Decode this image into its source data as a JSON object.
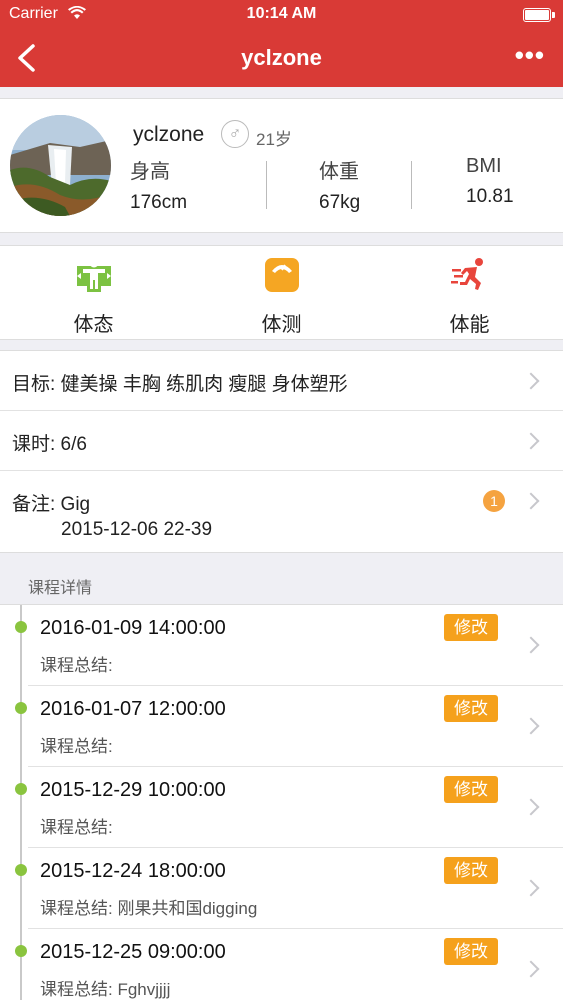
{
  "status_bar": {
    "carrier": "Carrier",
    "time": "10:14 AM"
  },
  "nav": {
    "title": "yclzone",
    "more": "•••"
  },
  "profile": {
    "name": "yclzone",
    "gender_symbol": "♂",
    "age": "21岁",
    "stats": [
      {
        "label": "身高",
        "value": "176cm"
      },
      {
        "label": "体重",
        "value": "67kg"
      },
      {
        "label": "BMI",
        "value": "10.81"
      }
    ]
  },
  "features": [
    {
      "label": "体态",
      "color": "#7cc242"
    },
    {
      "label": "体测",
      "color": "#f5a623"
    },
    {
      "label": "体能",
      "color": "#e8453c"
    }
  ],
  "info": {
    "goal": "目标: 健美操 丰胸 练肌肉 瘦腿 身体塑形",
    "lessons": "课时: 6/6",
    "note_label": "备注: Gig",
    "note_date": "2015-12-06 22-39",
    "note_badge": "1"
  },
  "section": {
    "title": "课程详情"
  },
  "sessions": [
    {
      "date": "2016-01-09 14:00:00",
      "summary": "课程总结:",
      "edit": "修改"
    },
    {
      "date": "2016-01-07 12:00:00",
      "summary": "课程总结:",
      "edit": "修改"
    },
    {
      "date": "2015-12-29 10:00:00",
      "summary": "课程总结:",
      "edit": "修改"
    },
    {
      "date": "2015-12-24 18:00:00",
      "summary": "课程总结:  刚果共和国digging",
      "edit": "修改"
    },
    {
      "date": "2015-12-25 09:00:00",
      "summary": "课程总结:  Fghvjjjj",
      "edit": "修改"
    }
  ]
}
